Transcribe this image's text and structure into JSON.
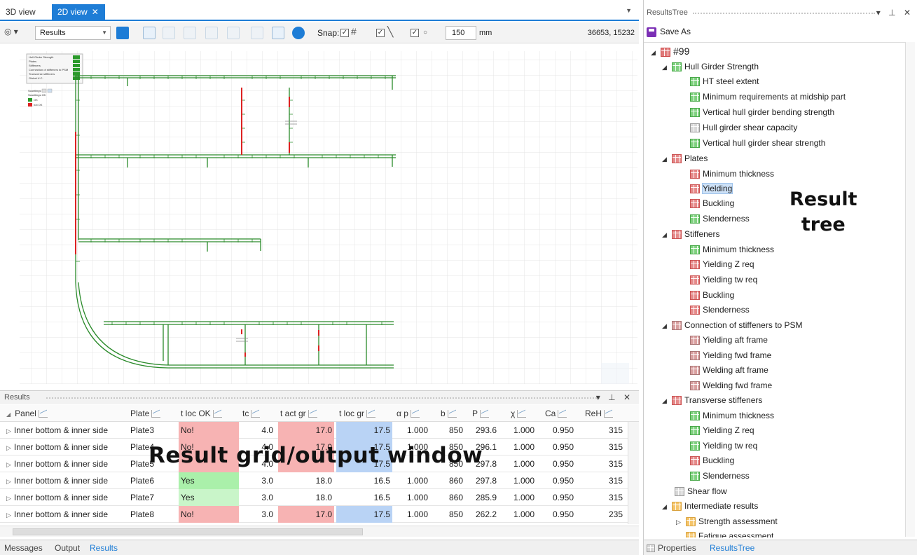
{
  "doc_tabs": {
    "tab1": "3D view",
    "tab2": "2D view",
    "close": "✕"
  },
  "toolbar": {
    "view_combo": "Results",
    "snap_label": "Snap:",
    "snap_value": "150",
    "unit": "mm",
    "coords": "36653, 15232"
  },
  "canvas_legend": {
    "items": [
      "Hull Girder Strength",
      "Plates",
      "Stiffeners",
      "Connection of stiffeners to PSM",
      "Transverse stiffeners",
      "Global U.C."
    ],
    "scantlings_label": "Scantlings",
    "scantlings_ok": "Scantlings OK",
    "ok": "OK",
    "not_ok": "not OK"
  },
  "results_panel": {
    "title": "Results",
    "columns": [
      "Panel",
      "Plate",
      "t loc OK",
      "tc",
      "t act gr",
      "t loc gr",
      "α p",
      "b",
      "P",
      "χ",
      "Ca",
      "ReH"
    ],
    "rows": [
      [
        "Inner bottom & inner side",
        "Plate3",
        "No!",
        "4.0",
        "17.0",
        "17.5",
        "1.000",
        "850",
        "293.6",
        "1.000",
        "0.950",
        "315"
      ],
      [
        "Inner bottom & inner side",
        "Plate4",
        "No!",
        "4.0",
        "17.0",
        "17.5",
        "1.000",
        "850",
        "296.1",
        "1.000",
        "0.950",
        "315"
      ],
      [
        "Inner bottom & inner side",
        "Plate5",
        "",
        "4.0",
        "",
        "17.5",
        "",
        "850",
        "297.8",
        "1.000",
        "0.950",
        "315"
      ],
      [
        "Inner bottom & inner side",
        "Plate6",
        "Yes",
        "3.0",
        "18.0",
        "16.5",
        "1.000",
        "860",
        "297.8",
        "1.000",
        "0.950",
        "315"
      ],
      [
        "Inner bottom & inner side",
        "Plate7",
        "Yes",
        "3.0",
        "18.0",
        "16.5",
        "1.000",
        "860",
        "285.9",
        "1.000",
        "0.950",
        "315"
      ],
      [
        "Inner bottom & inner side",
        "Plate8",
        "No!",
        "3.0",
        "17.0",
        "17.5",
        "1.000",
        "850",
        "262.2",
        "1.000",
        "0.950",
        "235"
      ]
    ]
  },
  "overlays": {
    "grid_caption": "Result grid/output window",
    "tree_caption_line1": "Result",
    "tree_caption_line2": "tree"
  },
  "bottom_tabs": {
    "messages": "Messages",
    "output": "Output",
    "results": "Results"
  },
  "results_tree": {
    "title": "ResultsTree",
    "save_as": "Save As",
    "root": "#99",
    "groups": [
      {
        "label": "Hull Girder Strength",
        "items": [
          "HT steel extent",
          "Minimum requirements at midship part",
          "Vertical hull girder bending strength",
          "Hull girder shear capacity",
          "Vertical hull girder shear strength"
        ]
      },
      {
        "label": "Plates",
        "items": [
          "Minimum thickness",
          "Yielding",
          "Buckling",
          "Slenderness"
        ]
      },
      {
        "label": "Stiffeners",
        "items": [
          "Minimum thickness",
          "Yielding Z req",
          "Yielding tw req",
          "Buckling",
          "Slenderness"
        ]
      },
      {
        "label": "Connection of stiffeners to PSM",
        "items": [
          "Yielding aft frame",
          "Yielding fwd frame",
          "Welding aft frame",
          "Welding fwd frame"
        ]
      },
      {
        "label": "Transverse stiffeners",
        "items": [
          "Minimum thickness",
          "Yielding Z req",
          "Yielding tw req",
          "Buckling",
          "Slenderness"
        ]
      }
    ],
    "shear_flow": "Shear flow",
    "intermediate": "Intermediate results",
    "strength_assessment": "Strength assessment",
    "fatigue_assessment": "Fatigue assessment"
  },
  "right_tabs": {
    "properties": "Properties",
    "results_tree": "ResultsTree"
  },
  "colors": {
    "accent": "#1e7dd6",
    "ok_green": "#aaf0aa",
    "fail_red": "#f7b3b3",
    "info_blue": "#b9d3f5"
  }
}
